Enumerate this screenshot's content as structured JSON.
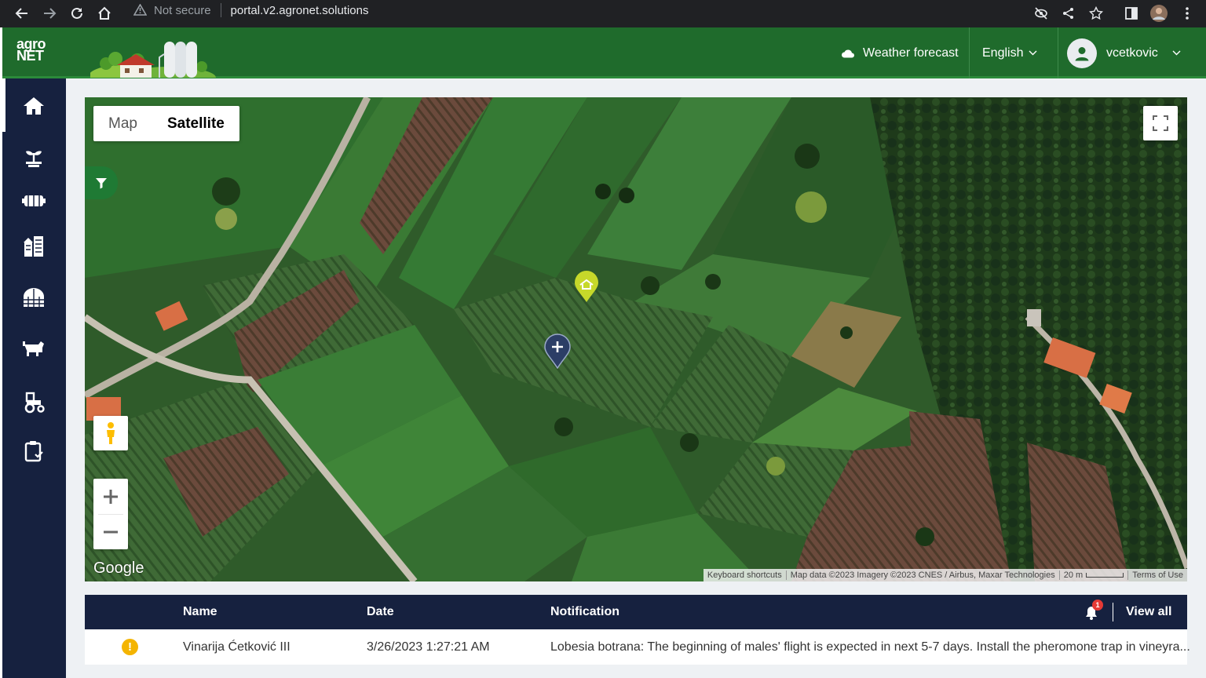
{
  "browser": {
    "security_label": "Not secure",
    "url": "portal.v2.agronet.solutions"
  },
  "header": {
    "logo_line1": "agro",
    "logo_line2": "NET",
    "weather_label": "Weather forecast",
    "language": "English",
    "username": "vcetkovic"
  },
  "sidebar": {
    "items": [
      {
        "icon": "home-icon"
      },
      {
        "icon": "plant-icon"
      },
      {
        "icon": "machinery-icon"
      },
      {
        "icon": "warehouse-icon"
      },
      {
        "icon": "greenhouse-icon"
      },
      {
        "icon": "livestock-icon"
      },
      {
        "icon": "tractor-icon"
      },
      {
        "icon": "reports-icon"
      }
    ]
  },
  "map": {
    "type_map": "Map",
    "type_satellite": "Satellite",
    "selected_type": "Satellite",
    "zoom_in": "+",
    "zoom_out": "−",
    "google_logo": "Google",
    "attribution": {
      "shortcuts": "Keyboard shortcuts",
      "data": "Map data ©2023 Imagery ©2023 CNES / Airbus, Maxar Technologies",
      "scale": "20 m",
      "terms": "Terms of Use"
    }
  },
  "notifications": {
    "columns": {
      "name": "Name",
      "date": "Date",
      "notification": "Notification"
    },
    "badge_count": "1",
    "view_all": "View all",
    "rows": [
      {
        "name": "Vinarija Ćetković III",
        "date": "3/26/2023 1:27:21 AM",
        "notification": "Lobesia botrana: The beginning of males' flight is expected in next 5-7 days. Install the pheromone trap in vineyra..."
      }
    ]
  },
  "colors": {
    "header_green": "#1f6b2c",
    "sidebar_navy": "#16213f",
    "accent_green": "#1f7a34",
    "marker_yellow": "#c6d82a",
    "marker_navy": "#2c3e66",
    "warning": "#f4b400",
    "badge_red": "#e53935"
  }
}
